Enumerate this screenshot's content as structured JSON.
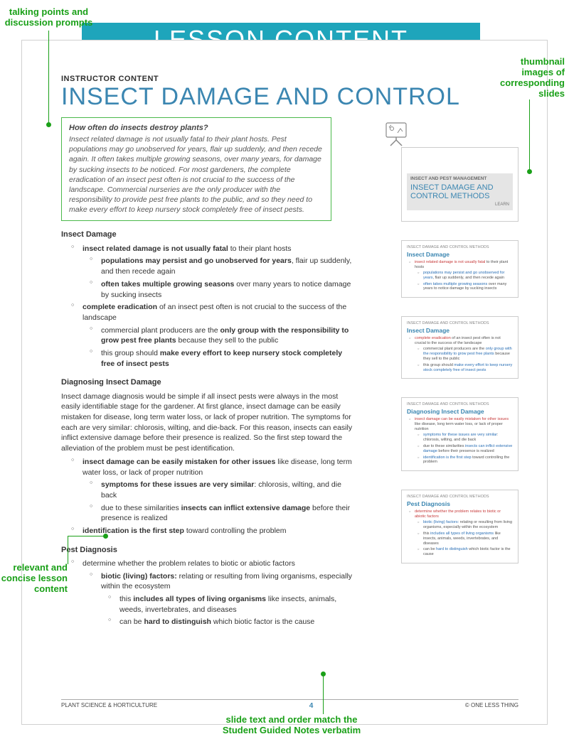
{
  "banner": "LESSON CONTENT",
  "annotations": {
    "top_left": "talking points and\ndiscussion prompts",
    "top_right": "thumbnail\nimages of\ncorresponding\nslides",
    "mid_left": "relevant and\nconcise lesson\ncontent",
    "bottom": "slide text and order match the\nStudent Guided Notes verbatim"
  },
  "page": {
    "instructor_label": "INSTRUCTOR CONTENT",
    "title": "INSECT DAMAGE AND CONTROL",
    "intro_question": "How often do insects destroy plants?",
    "intro_body": "Insect related damage is not usually fatal to their plant hosts. Pest populations may go unobserved for years, flair up suddenly, and then recede again. It often takes multiple growing seasons, over many years, for damage by sucking insects to be noticed. For most gardeners, the complete eradication of an insect pest often is not crucial to the success of the landscape. Commercial nurseries are the only producer with the responsibility to provide pest free plants to the public, and so they need to make every effort to keep nursery stock completely free of insect pests.",
    "sec1_head": "Insect Damage",
    "s1_a_pre": "insect related damage is not usually fatal",
    "s1_a_post": " to their plant hosts",
    "s1_a1_pre": "populations may persist and go unobserved for years",
    "s1_a1_post": ", flair up suddenly, and then recede again",
    "s1_a2_pre": "often takes multiple growing seasons",
    "s1_a2_post": " over many years to notice damage by sucking insects",
    "s1_b_pre": "complete eradication",
    "s1_b_post": " of an insect pest often is not crucial to the success of the landscape",
    "s1_b1_pre": "commercial plant producers are the ",
    "s1_b1_mid": "only group with the responsibility to grow pest free plants",
    "s1_b1_post": " because they sell to the public",
    "s1_b2_pre": "this group should ",
    "s1_b2_mid": "make every effort to keep nursery stock completely free of insect pests",
    "sec2_head": "Diagnosing Insect Damage",
    "sec2_para": "Insect damage diagnosis would be simple if all insect pests were always in the most easily identifiable stage for the gardener. At first glance, insect damage can be easily mistaken for disease, long term water loss, or lack of proper nutrition. The symptoms for each are very similar: chlorosis, wilting, and die-back. For this reason, insects can easily inflict extensive damage before their presence is realized. So the first step toward the alleviation of the problem must be pest identification.",
    "s2_a_pre": "insect damage can be easily mistaken for other issues",
    "s2_a_post": " like disease, long term water loss, or lack of proper nutrition",
    "s2_a1_pre": "symptoms for these issues are very similar",
    "s2_a1_post": ": chlorosis, wilting, and die back",
    "s2_a2_pre": "due to these similarities ",
    "s2_a2_mid": "insects can inflict extensive damage",
    "s2_a2_post": " before their presence is realized",
    "s2_b_pre": "identification is the first step",
    "s2_b_post": " toward controlling the problem",
    "sec3_head": "Pest Diagnosis",
    "s3_a": "determine whether the problem relates to biotic or abiotic factors",
    "s3_a1_pre": "biotic (living) factors:",
    "s3_a1_post": " relating or resulting from living organisms, especially within the ecosystem",
    "s3_a1a_pre": "this ",
    "s3_a1a_mid": "includes all types of living organisms",
    "s3_a1a_post": " like insects, animals, weeds, invertebrates, and diseases",
    "s3_a1b_pre": "can be ",
    "s3_a1b_mid": "hard to distinguish",
    "s3_a1b_post": " which biotic factor is the cause",
    "footer_left": "PLANT SCIENCE & HORTICULTURE",
    "footer_page": "4",
    "footer_right": "© ONE LESS THING"
  },
  "thumbs": {
    "hero_cat": "INSECT AND PEST MANAGEMENT",
    "hero_title": "INSECT DAMAGE AND CONTROL METHODS",
    "hero_learn": "LEARN",
    "cat": "INSECT DAMAGE AND CONTROL METHODS",
    "t2_title": "Insect Damage",
    "t3_title": "Insect Damage",
    "t4_title": "Diagnosing Insect Damage",
    "t5_title": "Pest Diagnosis"
  }
}
